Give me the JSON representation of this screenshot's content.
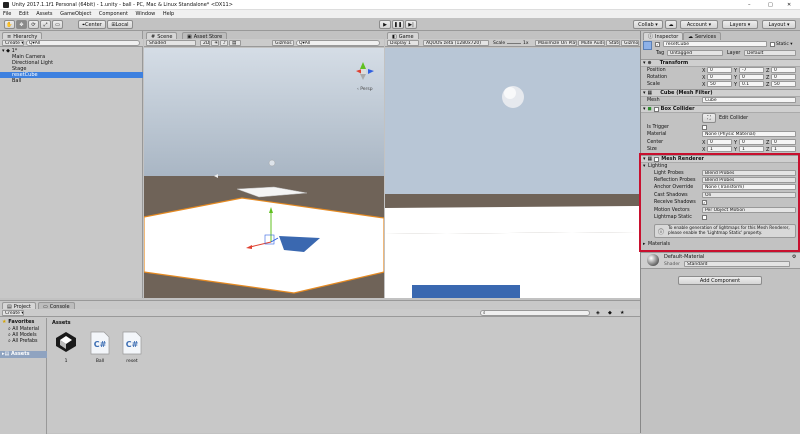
{
  "window": {
    "title": "Unity 2017.1.1f1 Personal (64bit) - 1.unity - ball - PC, Mac & Linux Standalone* <DX11>",
    "controls": [
      "–",
      "□",
      "✕"
    ]
  },
  "menu": [
    "File",
    "Edit",
    "Assets",
    "GameObject",
    "Component",
    "Window",
    "Help"
  ],
  "toolbar": {
    "center": "Center",
    "local": "Local",
    "collab": "Collab ▾",
    "account": "Account ▾",
    "layers": "Layers ▾",
    "layout": "Layout ▾"
  },
  "hierarchy": {
    "tab": "Hierarchy",
    "create": "Create ▾",
    "search_placeholder": "Q▾All",
    "scene": "1*",
    "items": [
      "Main Camera",
      "Directional Light",
      "Stage",
      "resetCube",
      "Ball"
    ],
    "selected_index": 3
  },
  "scene": {
    "tab": "Scene",
    "asset_store_tab": "Asset Store",
    "shaded": "Shaded",
    "mode_2d": "2D",
    "gizmos": "Gizmos ▾",
    "search": "Q▾All",
    "persp": "‹ Persp"
  },
  "game": {
    "tab": "Game",
    "display": "Display 1",
    "resolution": "AQUOS zeta (1280x720)",
    "scale_label": "Scale",
    "scale_value": "1x",
    "maximize": "Maximize On Play",
    "mute": "Mute Audio",
    "stats": "Stats",
    "gizmos": "Gizmos ▾"
  },
  "project": {
    "tab": "Project",
    "console_tab": "Console",
    "create": "Create ▾",
    "favorites": "Favorites",
    "favorites_items": [
      "All Material",
      "All Models",
      "All Prefabs"
    ],
    "assets_folder": "Assets",
    "breadcrumb": "Assets",
    "files": [
      {
        "name": "1",
        "icon": "unity-scene-icon"
      },
      {
        "name": "Ball",
        "icon": "csharp-script-icon"
      },
      {
        "name": "reset",
        "icon": "csharp-script-icon"
      }
    ]
  },
  "inspector": {
    "tab": "Inspector",
    "services_tab": "Services",
    "object_name": "resetCube",
    "static": "Static ▾",
    "tag_label": "Tag",
    "tag_value": "Untagged",
    "layer_label": "Layer",
    "layer_value": "Default",
    "transform": {
      "title": "Transform",
      "position_label": "Position",
      "position": {
        "x": "0",
        "y": "-7",
        "z": "0"
      },
      "rotation_label": "Rotation",
      "rotation": {
        "x": "0",
        "y": "0",
        "z": "0"
      },
      "scale_label": "Scale",
      "scale": {
        "x": "50",
        "y": "0.1",
        "z": "50"
      }
    },
    "mesh_filter": {
      "title": "Cube (Mesh Filter)",
      "mesh_label": "Mesh",
      "mesh_value": "Cube"
    },
    "box_collider": {
      "title": "Box Collider",
      "edit": "Edit Collider",
      "is_trigger": "Is Trigger",
      "material_label": "Material",
      "material_value": "None (Physic Material)",
      "center_label": "Center",
      "center": {
        "x": "0",
        "y": "0",
        "z": "0"
      },
      "size_label": "Size",
      "size": {
        "x": "1",
        "y": "1",
        "z": "1"
      }
    },
    "mesh_renderer": {
      "title": "Mesh Renderer",
      "lighting": "Lighting",
      "light_probes_label": "Light Probes",
      "light_probes": "Blend Probes",
      "reflection_probes_label": "Reflection Probes",
      "reflection_probes": "Blend Probes",
      "anchor_label": "Anchor Override",
      "anchor": "None (Transform)",
      "cast_shadows_label": "Cast Shadows",
      "cast_shadows": "On",
      "receive_shadows": "Receive Shadows",
      "motion_vectors_label": "Motion Vectors",
      "motion_vectors": "Per Object Motion",
      "lightmap_static": "Lightmap Static",
      "info": "To enable generation of lightmaps for this Mesh Renderer, please enable the 'Lightmap Static' property.",
      "materials": "Materials"
    },
    "material": {
      "name": "Default-Material",
      "shader_label": "Shader",
      "shader_value": "Standard"
    },
    "add_component": "Add Component"
  },
  "colors": {
    "highlight_border": "#c8102e",
    "selection": "#3d80df",
    "sky": "#b8c6d6",
    "ground": "#6f6358",
    "stage_edge": "#e58a22",
    "gizmo_x": "#e04030",
    "gizmo_y": "#60c020",
    "gizmo_z": "#3060e0"
  }
}
